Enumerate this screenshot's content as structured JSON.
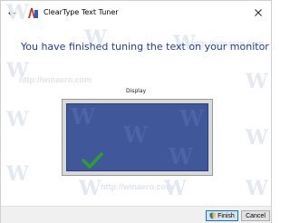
{
  "window": {
    "title": "ClearType Text Tuner",
    "back_icon": "back-arrow-icon",
    "close_icon": "close-icon",
    "app_icon": "cleartype-app-icon"
  },
  "main": {
    "heading": "You have finished tuning the text on your monitor",
    "display_label": "Display",
    "monitor_check_icon": "checkmark-icon",
    "screen_color": "#40579a",
    "check_color": "#2f9e2a"
  },
  "watermark": {
    "glyph": "W",
    "text": "http://winaero.com"
  },
  "footer": {
    "finish_label": "Finish",
    "finish_icon": "uac-shield-icon",
    "cancel_label": "Cancel"
  },
  "colors": {
    "heading": "#1e3f9e",
    "accent": "#0078d7"
  }
}
